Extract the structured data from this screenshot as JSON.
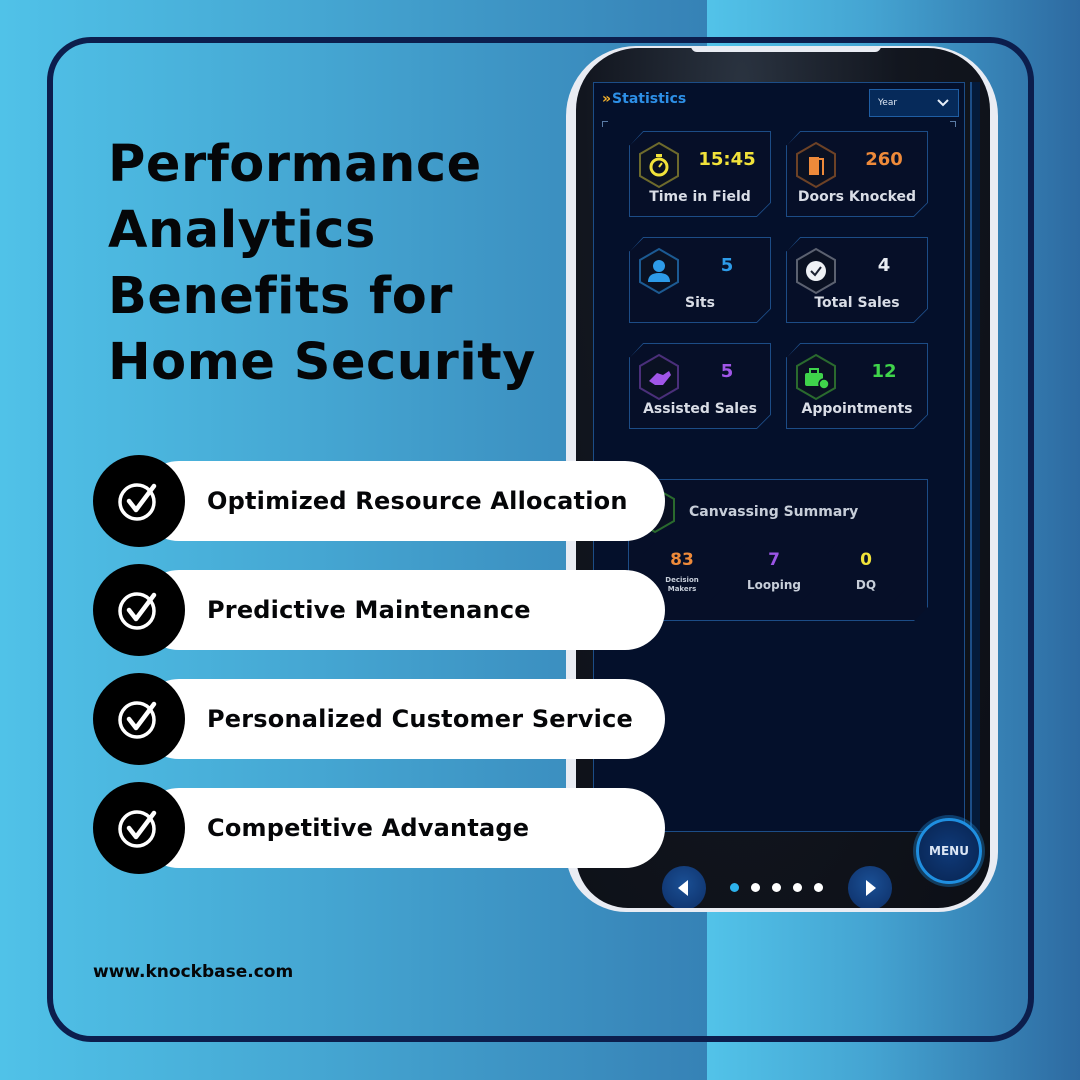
{
  "headline": {
    "lines": [
      "Performance",
      "Analytics",
      "Benefits for",
      "Home Security"
    ]
  },
  "benefits": [
    {
      "label": "Optimized Resource Allocation",
      "icon": "check-circle-icon"
    },
    {
      "label": "Predictive Maintenance",
      "icon": "check-circle-icon"
    },
    {
      "label": "Personalized Customer Service",
      "icon": "check-circle-icon"
    },
    {
      "label": "Competitive Advantage",
      "icon": "check-circle-icon"
    }
  ],
  "footer": {
    "url": "www.knockbase.com"
  },
  "app": {
    "panel_title": "Statistics",
    "period_select": {
      "selected": "Year"
    },
    "stats": [
      {
        "label": "Time in Field",
        "value": "15:45",
        "icon": "stopwatch-icon",
        "color": "#f1e23a"
      },
      {
        "label": "Doors Knocked",
        "value": "260",
        "icon": "door-icon",
        "color": "#ee8a3a"
      },
      {
        "label": "Sits",
        "value": "5",
        "icon": "person-icon",
        "color": "#2d9be8"
      },
      {
        "label": "Total Sales",
        "value": "4",
        "icon": "check-badge-icon",
        "color": "#e8ecf2"
      },
      {
        "label": "Assisted Sales",
        "value": "5",
        "icon": "handshake-icon",
        "color": "#a056e8"
      },
      {
        "label": "Appointments",
        "value": "12",
        "icon": "briefcase-clock-icon",
        "color": "#3fd44b"
      }
    ],
    "summary": {
      "title": "Canvassing Summary",
      "icon": "rocket-icon",
      "items": [
        {
          "label_line1": "Decision",
          "label_line2": "Makers",
          "value": "83",
          "color": "#ee8a3a"
        },
        {
          "label": "Looping",
          "value": "7",
          "color": "#9a55e6"
        },
        {
          "label": "DQ",
          "value": "0",
          "color": "#f1e23a"
        }
      ]
    },
    "pager": {
      "total": 5,
      "active": 1
    },
    "menu_label": "MENU"
  }
}
